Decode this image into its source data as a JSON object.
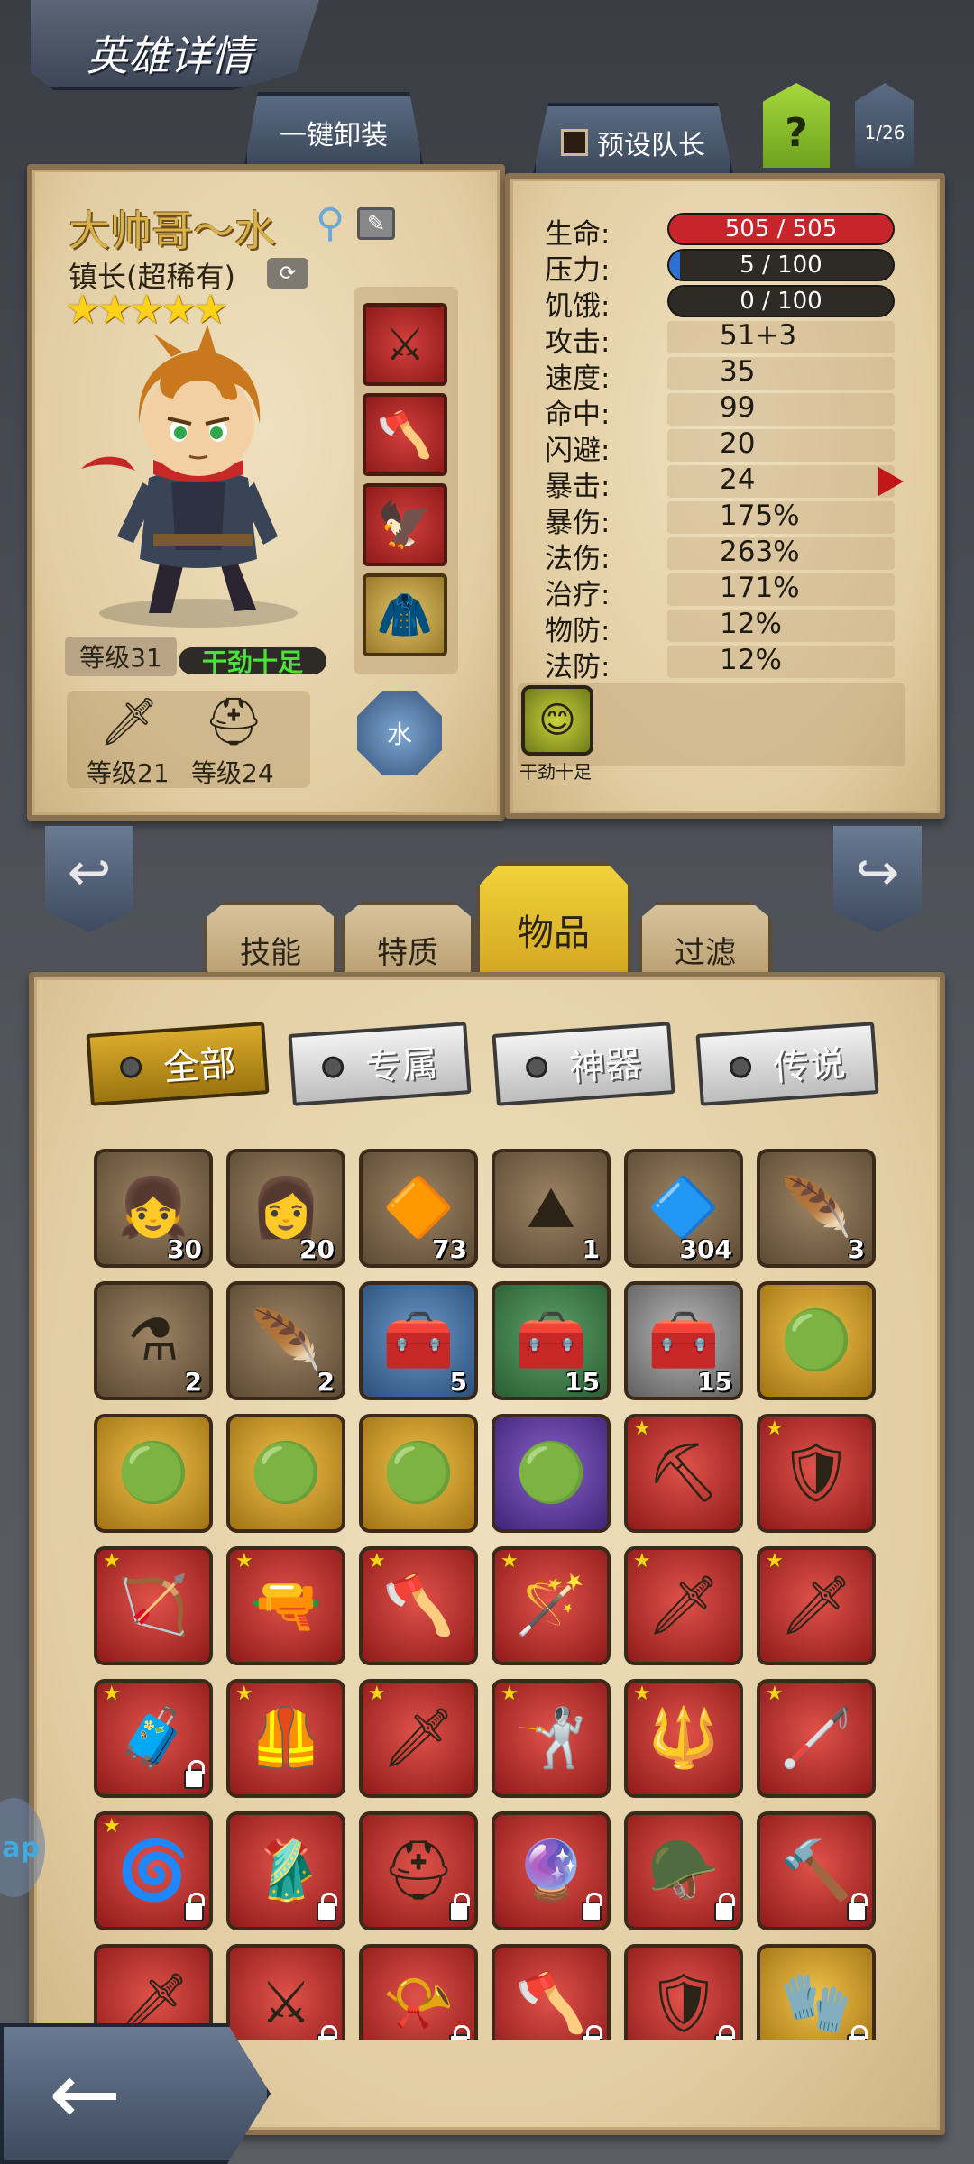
{
  "page_title": "英雄详情",
  "top_tabs": {
    "unequip_all": "一键卸装",
    "preset_captain": "预设队长",
    "help": "?",
    "page_indicator": "1/26"
  },
  "hero": {
    "name": "大帅哥～水",
    "class": "镇长(超稀有)",
    "stars": "★★★★★",
    "level": "等级31",
    "mood": "干劲十足",
    "weapon_level": "等级21",
    "armor_level": "等级24",
    "element": "水"
  },
  "stats": {
    "hp": {
      "label": "生命:",
      "value": "505 / 505",
      "fill": 1.0
    },
    "stress": {
      "label": "压力:",
      "value": "5 / 100",
      "fill": 0.05
    },
    "hunger": {
      "label": "饥饿:",
      "value": "0 / 100",
      "fill": 0.0
    },
    "attack": {
      "label": "攻击:",
      "value": "51+3"
    },
    "speed": {
      "label": "速度:",
      "value": "35"
    },
    "accuracy": {
      "label": "命中:",
      "value": "99"
    },
    "dodge": {
      "label": "闪避:",
      "value": "20"
    },
    "crit": {
      "label": "暴击:",
      "value": "24"
    },
    "crit_damage": {
      "label": "暴伤:",
      "value": "175%"
    },
    "magic_damage": {
      "label": "法伤:",
      "value": "263%"
    },
    "healing": {
      "label": "治疗:",
      "value": "171%"
    },
    "physical_def": {
      "label": "物防:",
      "value": "12%"
    },
    "magic_def": {
      "label": "法防:",
      "value": "12%"
    }
  },
  "trait": {
    "label": "干劲十足",
    "icon": "smiley-bubble-icon"
  },
  "section_tabs": {
    "skills": "技能",
    "traits": "特质",
    "items": "物品",
    "filter": "过滤"
  },
  "filters": {
    "all": "全部",
    "exclusive": "专属",
    "artifact": "神器",
    "legendary": "传说"
  },
  "side_peek": "ap",
  "colors": {
    "hp_bar": "#c8242c",
    "stress_bar": "#2f6fd0",
    "active_tab": "#f2d23b",
    "mood_text": "#4ae33a"
  },
  "items": [
    {
      "icon": "green-hair-hero-portrait-icon",
      "glyph": "👧",
      "rarity": "brown",
      "count": "30"
    },
    {
      "icon": "brown-hair-hero-portrait-icon",
      "glyph": "👩",
      "rarity": "brown",
      "count": "20"
    },
    {
      "icon": "orange-rune-gem-icon",
      "glyph": "🔶",
      "rarity": "brown",
      "count": "73"
    },
    {
      "icon": "sand-pile-icon",
      "glyph": "⛰",
      "rarity": "brown",
      "count": "1"
    },
    {
      "icon": "cyan-rune-stone-icon",
      "glyph": "🔷",
      "rarity": "brown",
      "count": "304"
    },
    {
      "icon": "golden-feather-icon",
      "glyph": "🪶",
      "rarity": "brown",
      "count": "3"
    },
    {
      "icon": "blue-potion-icon",
      "glyph": "⚗",
      "rarity": "brown",
      "count": "2"
    },
    {
      "icon": "white-feather-icon",
      "glyph": "🪶",
      "rarity": "brown",
      "count": "2"
    },
    {
      "icon": "treasure-chest-blue-icon",
      "glyph": "🧰",
      "rarity": "blue",
      "count": "5"
    },
    {
      "icon": "treasure-chest-green-icon",
      "glyph": "🧰",
      "rarity": "green",
      "count": "15"
    },
    {
      "icon": "treasure-chest-grey-icon",
      "glyph": "🧰",
      "rarity": "grey",
      "count": "15"
    },
    {
      "icon": "green-orb-icon",
      "glyph": "🟢",
      "rarity": "gold",
      "count": ""
    },
    {
      "icon": "green-orb-icon",
      "glyph": "🟢",
      "rarity": "gold",
      "count": ""
    },
    {
      "icon": "green-orb-icon",
      "glyph": "🟢",
      "rarity": "gold",
      "count": ""
    },
    {
      "icon": "green-orb-icon",
      "glyph": "🟢",
      "rarity": "gold",
      "count": ""
    },
    {
      "icon": "green-orb-icon",
      "glyph": "🟢",
      "rarity": "purple",
      "count": ""
    },
    {
      "icon": "pickaxe-icon",
      "glyph": "⛏",
      "rarity": "red",
      "star": true
    },
    {
      "icon": "shield-icon",
      "glyph": "🛡",
      "rarity": "red",
      "star": true
    },
    {
      "icon": "crossbow-icon",
      "glyph": "🏹",
      "rarity": "red",
      "star": true
    },
    {
      "icon": "rifle-icon",
      "glyph": "🔫",
      "rarity": "red",
      "star": true
    },
    {
      "icon": "battle-axe-icon",
      "glyph": "🪓",
      "rarity": "red",
      "star": true
    },
    {
      "icon": "magic-staff-icon",
      "glyph": "🪄",
      "rarity": "red",
      "star": true
    },
    {
      "icon": "flaming-sword-icon",
      "glyph": "🗡",
      "rarity": "red",
      "star": true
    },
    {
      "icon": "flaming-sword-icon",
      "glyph": "🗡",
      "rarity": "red",
      "star": true
    },
    {
      "icon": "medkit-icon",
      "glyph": "🧳",
      "rarity": "red",
      "star": true,
      "lock": true
    },
    {
      "icon": "dark-armor-icon",
      "glyph": "🦺",
      "rarity": "red",
      "star": true
    },
    {
      "icon": "sword-icon",
      "glyph": "🗡",
      "rarity": "red",
      "star": true
    },
    {
      "icon": "rapier-icon",
      "glyph": "🤺",
      "rarity": "red",
      "star": true
    },
    {
      "icon": "mace-icon",
      "glyph": "🔱",
      "rarity": "red",
      "star": true
    },
    {
      "icon": "black-staff-icon",
      "glyph": "🦯",
      "rarity": "red",
      "star": true
    },
    {
      "icon": "water-staff-icon",
      "glyph": "🌀",
      "rarity": "red",
      "star": true,
      "lock": true
    },
    {
      "icon": "red-robe-icon",
      "glyph": "🥻",
      "rarity": "red",
      "lock": true
    },
    {
      "icon": "golden-helmet-icon",
      "glyph": "⛑",
      "rarity": "red",
      "lock": true
    },
    {
      "icon": "blue-orb-amulet-icon",
      "glyph": "🔮",
      "rarity": "red",
      "lock": true
    },
    {
      "icon": "golden-hood-icon",
      "glyph": "🪖",
      "rarity": "red",
      "lock": true
    },
    {
      "icon": "war-hammer-icon",
      "glyph": "🔨",
      "rarity": "red",
      "lock": true
    },
    {
      "icon": "red-blade-icon",
      "glyph": "🗡",
      "rarity": "red"
    },
    {
      "icon": "crystal-sword-icon",
      "glyph": "⚔",
      "rarity": "red",
      "lock": true
    },
    {
      "icon": "horn-icon",
      "glyph": "📯",
      "rarity": "red",
      "lock": true
    },
    {
      "icon": "double-axe-icon",
      "glyph": "🪓",
      "rarity": "red",
      "lock": true
    },
    {
      "icon": "mystic-armor-icon",
      "glyph": "🛡",
      "rarity": "red",
      "lock": true
    },
    {
      "icon": "dark-gauntlet-icon",
      "glyph": "🧤",
      "rarity": "gold",
      "lock": true
    }
  ]
}
